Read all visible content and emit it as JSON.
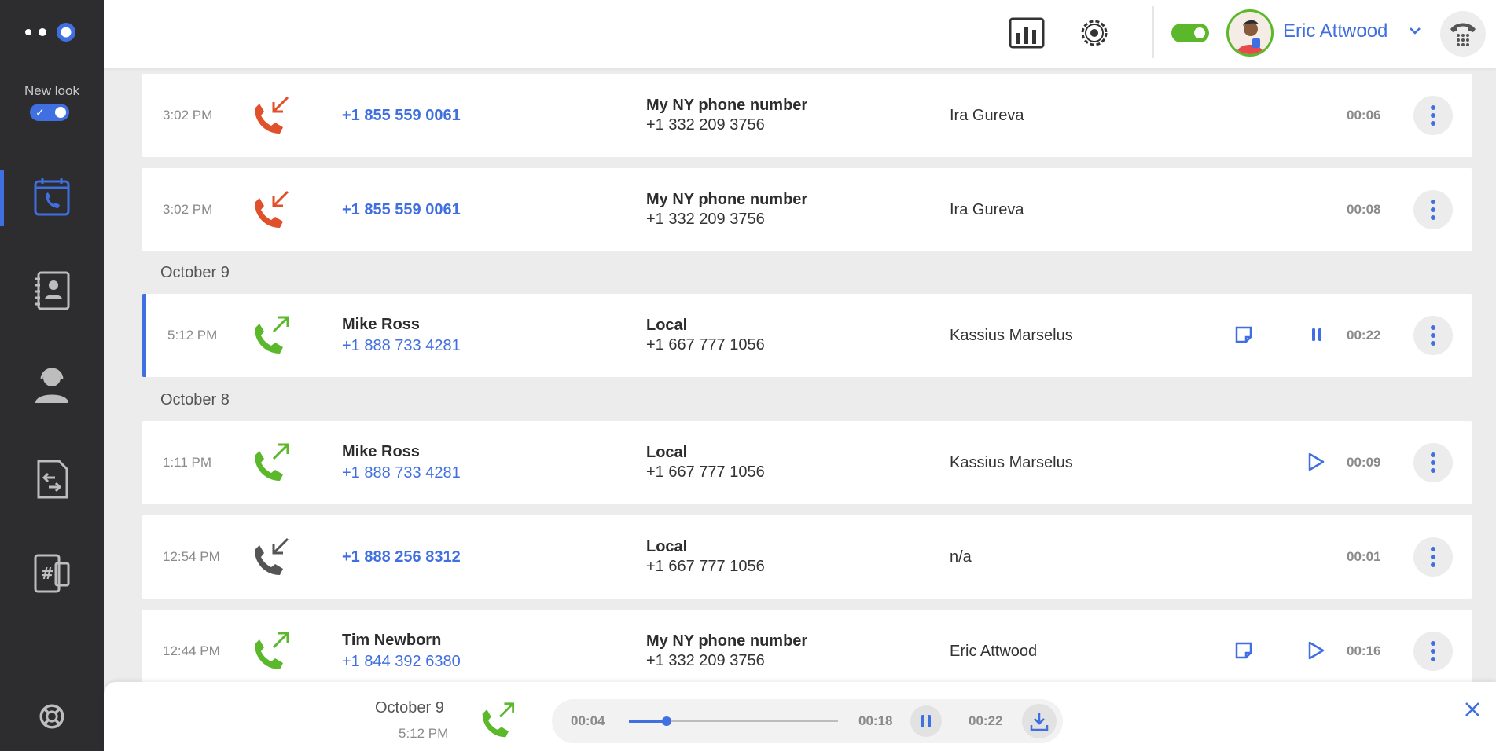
{
  "sidebar": {
    "new_look_label": "New look",
    "nav": [
      {
        "name": "calls",
        "icon": "call-log-icon",
        "active": true
      },
      {
        "name": "contacts",
        "icon": "contacts-book-icon",
        "active": false
      },
      {
        "name": "agents",
        "icon": "agent-headset-icon",
        "active": false
      },
      {
        "name": "call-flows",
        "icon": "call-flow-icon",
        "active": false
      },
      {
        "name": "numbers",
        "icon": "phone-numbers-icon",
        "active": false
      }
    ],
    "help_icon": "lifebuoy-icon"
  },
  "header": {
    "user_name": "Eric Attwood",
    "status_on": true
  },
  "colors": {
    "accent": "#3f6fe0",
    "incoming_missed": "#e0502b",
    "outgoing": "#5cb82b",
    "incoming_neutral": "#555555"
  },
  "calls": [
    {
      "time": "3:02 PM",
      "direction": "incoming-missed",
      "caller_name": "",
      "caller_number": "+1 855 559 0061",
      "line_name": "My NY phone number",
      "line_number": "+1 332 209 3756",
      "agent": "Ira Gureva",
      "has_note": false,
      "recording": "none",
      "duration": "00:06"
    },
    {
      "time": "3:02 PM",
      "direction": "incoming-missed",
      "caller_name": "",
      "caller_number": "+1 855 559 0061",
      "line_name": "My NY phone number",
      "line_number": "+1 332 209 3756",
      "agent": "Ira Gureva",
      "has_note": false,
      "recording": "none",
      "duration": "00:08"
    },
    {
      "time": "5:12 PM",
      "direction": "outgoing",
      "caller_name": "Mike Ross",
      "caller_number": "+1 888 733 4281",
      "line_name": "Local",
      "line_number": "+1 667 777 1056",
      "agent": "Kassius Marselus",
      "has_note": true,
      "recording": "pause",
      "duration": "00:22"
    },
    {
      "time": "1:11 PM",
      "direction": "outgoing",
      "caller_name": "Mike Ross",
      "caller_number": "+1 888 733 4281",
      "line_name": "Local",
      "line_number": "+1 667 777 1056",
      "agent": "Kassius Marselus",
      "has_note": false,
      "recording": "play",
      "duration": "00:09"
    },
    {
      "time": "12:54 PM",
      "direction": "incoming",
      "caller_name": "",
      "caller_number": "+1 888 256 8312",
      "line_name": "Local",
      "line_number": "+1 667 777 1056",
      "agent": "n/a",
      "has_note": false,
      "recording": "none",
      "duration": "00:01"
    },
    {
      "time": "12:44 PM",
      "direction": "outgoing",
      "caller_name": "Tim Newborn",
      "caller_number": "+1 844 392 6380",
      "line_name": "My NY phone number",
      "line_number": "+1 332 209 3756",
      "agent": "Eric Attwood",
      "has_note": true,
      "recording": "play",
      "duration": "00:16"
    }
  ],
  "date_groups": [
    "October 9",
    "October 8"
  ],
  "player": {
    "date": "October 9",
    "time": "5:12 PM",
    "elapsed": "00:04",
    "remaining": "00:18",
    "total": "00:22",
    "progress_fraction": 0.18
  }
}
